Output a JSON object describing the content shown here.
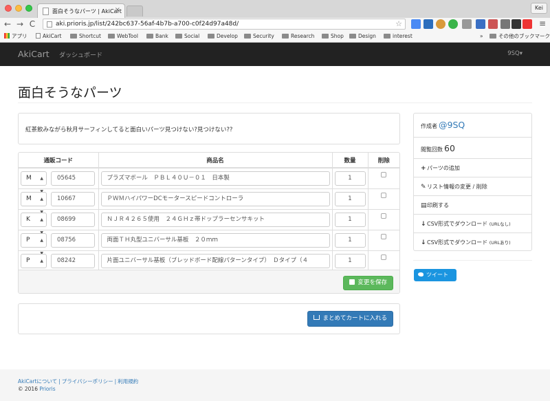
{
  "browser": {
    "tab_title": "面白そうなパーツ | AkiCart",
    "tab_close": "×",
    "profile": "Kei",
    "url": "aki.prioris.jp/list/242bc637-56af-4b7b-a700-c0f24d97a48d/",
    "back": "←",
    "forward": "→",
    "reload": "C",
    "star": "☆",
    "menu": "≡",
    "bookmarks": [
      "アプリ",
      "AkiCart",
      "Shortcut",
      "WebTool",
      "Bank",
      "Social",
      "Develop",
      "Security",
      "Research",
      "Shop",
      "Design",
      "interest"
    ],
    "other_bookmarks": "その他のブックマーク",
    "overflow": "»"
  },
  "navbar": {
    "brand": "AkiCart",
    "dashboard": "ダッシュボード",
    "user": "9SQ",
    "caret": "▾"
  },
  "page": {
    "title": "面白そうなパーツ",
    "description": "紅茶飲みながら秋月サーフィンしてると面白いパーツ見つけない?見つけない??"
  },
  "table": {
    "headers": {
      "code": "通販コード",
      "name": "商品名",
      "qty": "数量",
      "delete": "削除"
    },
    "rows": [
      {
        "prefix": "M",
        "code": "05645",
        "name": "プラズマボール　ＰＢＬ４０Ｕ－０１　日本製",
        "qty": "1"
      },
      {
        "prefix": "M",
        "code": "10667",
        "name": "ＰＷＭハイパワーDCモータースピードコントローラ",
        "qty": "1"
      },
      {
        "prefix": "K",
        "code": "08699",
        "name": "ＮＪＲ４２６５使用　２４ＧＨｚ帯ドップラーセンサキット",
        "qty": "1"
      },
      {
        "prefix": "P",
        "code": "08756",
        "name": "両面ＴＨ丸型ユニバーサル基板　２０ｍｍ",
        "qty": "1"
      },
      {
        "prefix": "P",
        "code": "08242",
        "name": "片面ユニバーサル基板（ブレッドボード配線パターンタイプ）　Ｄタイプ（４",
        "qty": "1"
      }
    ],
    "save_label": "変更を保存"
  },
  "cart": {
    "label": "まとめてカートに入れる"
  },
  "sidebar": {
    "author_label": "作成者",
    "author": "@9SQ",
    "views_label": "閲覧回数",
    "views": "60",
    "add_part": "パーツの追加",
    "edit_list": "リスト情報の変更 / 削除",
    "print": "印刷する",
    "csv_plain": "CSV形式でダウンロード",
    "csv_plain_note": "(URLなし)",
    "csv_url": "CSV形式でダウンロード",
    "csv_url_note": "(URLあり)",
    "icon_plus": "+",
    "icon_pencil": "✎",
    "icon_print": "▤",
    "icon_download": "↓",
    "tweet": "ツイート"
  },
  "footer": {
    "about": "AkiCartについて",
    "sep": "|",
    "privacy": "プライバシーポリシー",
    "terms": "利用規約",
    "copyright": "© 2016",
    "company": "Prioris"
  },
  "colors": {
    "navbar": "#222222",
    "link": "#337ab7",
    "save_button": "#5cb85c",
    "cart_button": "#337ab7",
    "tweet_button": "#1b95e0"
  }
}
